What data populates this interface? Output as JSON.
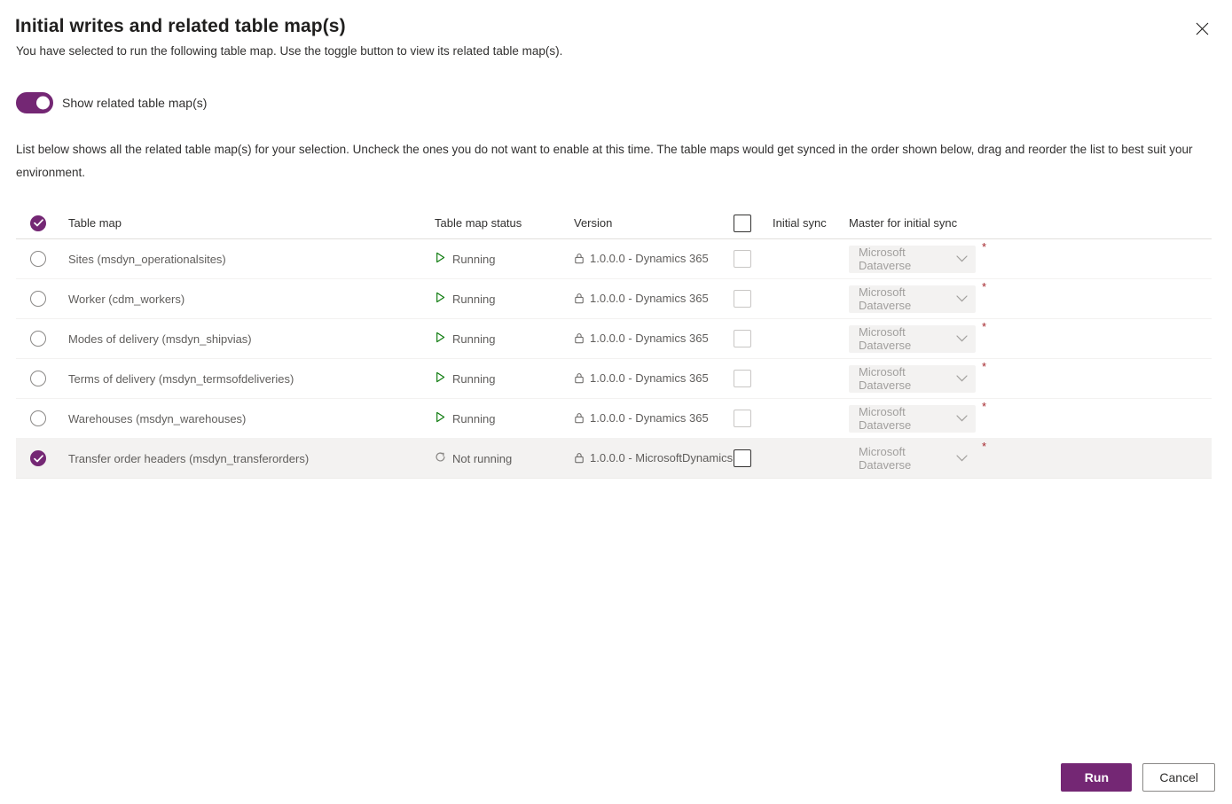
{
  "dialog": {
    "title": "Initial writes and related table map(s)",
    "subtitle": "You have selected to run the following table map. Use the toggle button to view its related table map(s).",
    "close_label": "Close",
    "description": "List below shows all the related table map(s) for your selection. Uncheck the ones you do not want to enable at this time. The table maps would get synced in the order shown below, drag and reorder the list to best suit your environment."
  },
  "toggle": {
    "label": "Show related table map(s)",
    "state": "on",
    "accent_color": "#742774"
  },
  "table": {
    "columns": {
      "select": "",
      "name": "Table map",
      "status": "Table map status",
      "version": "Version",
      "initial_sync": "Initial sync",
      "master": "Master for initial sync"
    },
    "header_select_checked": true,
    "header_initial_sync_checked": false,
    "rows": [
      {
        "name": "Sites (msdyn_operationalsites)",
        "status": "Running",
        "status_icon": "play-icon",
        "version": "1.0.0.0 - Dynamics 365",
        "version_icon": "lock-icon",
        "selected": false,
        "initial_sync_checked": false,
        "master": "Microsoft Dataverse",
        "master_required": "*"
      },
      {
        "name": "Worker (cdm_workers)",
        "status": "Running",
        "status_icon": "play-icon",
        "version": "1.0.0.0 - Dynamics 365",
        "version_icon": "lock-icon",
        "selected": false,
        "initial_sync_checked": false,
        "master": "Microsoft Dataverse",
        "master_required": "*"
      },
      {
        "name": "Modes of delivery (msdyn_shipvias)",
        "status": "Running",
        "status_icon": "play-icon",
        "version": "1.0.0.0 - Dynamics 365",
        "version_icon": "lock-icon",
        "selected": false,
        "initial_sync_checked": false,
        "master": "Microsoft Dataverse",
        "master_required": "*"
      },
      {
        "name": "Terms of delivery (msdyn_termsofdeliveries)",
        "status": "Running",
        "status_icon": "play-icon",
        "version": "1.0.0.0 - Dynamics 365",
        "version_icon": "lock-icon",
        "selected": false,
        "initial_sync_checked": false,
        "master": "Microsoft Dataverse",
        "master_required": "*"
      },
      {
        "name": "Warehouses (msdyn_warehouses)",
        "status": "Running",
        "status_icon": "play-icon",
        "version": "1.0.0.0 - Dynamics 365",
        "version_icon": "lock-icon",
        "selected": false,
        "initial_sync_checked": false,
        "master": "Microsoft Dataverse",
        "master_required": "*"
      },
      {
        "name": "Transfer order headers (msdyn_transferorders)",
        "status": "Not running",
        "status_icon": "pending-icon",
        "version": "1.0.0.0 - MicrosoftDynamics",
        "version_icon": "lock-icon",
        "selected": true,
        "initial_sync_checked": false,
        "master": "Microsoft Dataverse",
        "master_required": "*"
      }
    ]
  },
  "footer": {
    "run_label": "Run",
    "cancel_label": "Cancel"
  }
}
